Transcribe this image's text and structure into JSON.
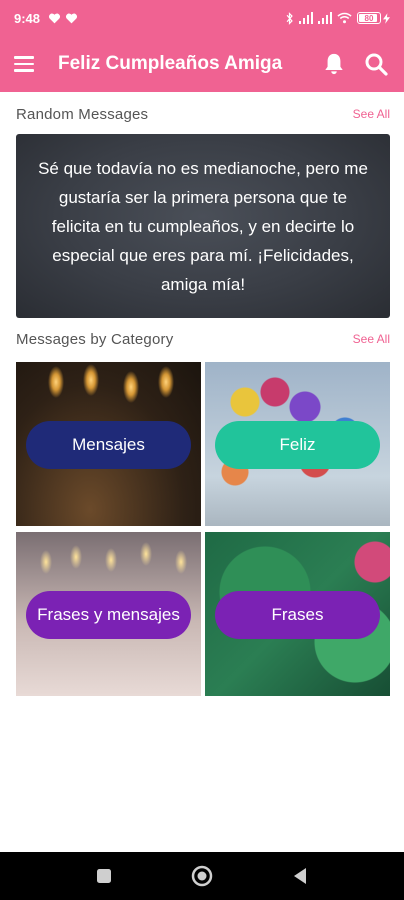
{
  "status_bar": {
    "time": "9:48",
    "battery": "80"
  },
  "app_bar": {
    "title": "Feliz Cumpleaños Amiga"
  },
  "random_section": {
    "title": "Random Messages",
    "see_all": "See All",
    "message": "Sé que todavía no es medianoche, pero me gustaría ser la primera persona que te felicita en tu cumpleaños, y en decirte lo especial que eres para mí. ¡Felicidades, amiga mía!"
  },
  "category_section": {
    "title": "Messages by Category",
    "see_all": "See All",
    "categories": [
      {
        "label": "Mensajes",
        "color": "#1f2a78"
      },
      {
        "label": "Feliz",
        "color": "#21c49b"
      },
      {
        "label": "Frases y mensajes",
        "color": "#7b22b4"
      },
      {
        "label": "Frases",
        "color": "#7b22b4"
      }
    ]
  },
  "colors": {
    "primary": "#f06292",
    "accent_text": "#f06292"
  },
  "icons": {
    "menu": "menu-icon",
    "notifications": "bell-icon",
    "search": "search-icon",
    "nav_recents": "square-icon",
    "nav_home": "circle-icon",
    "nav_back": "triangle-back-icon"
  }
}
